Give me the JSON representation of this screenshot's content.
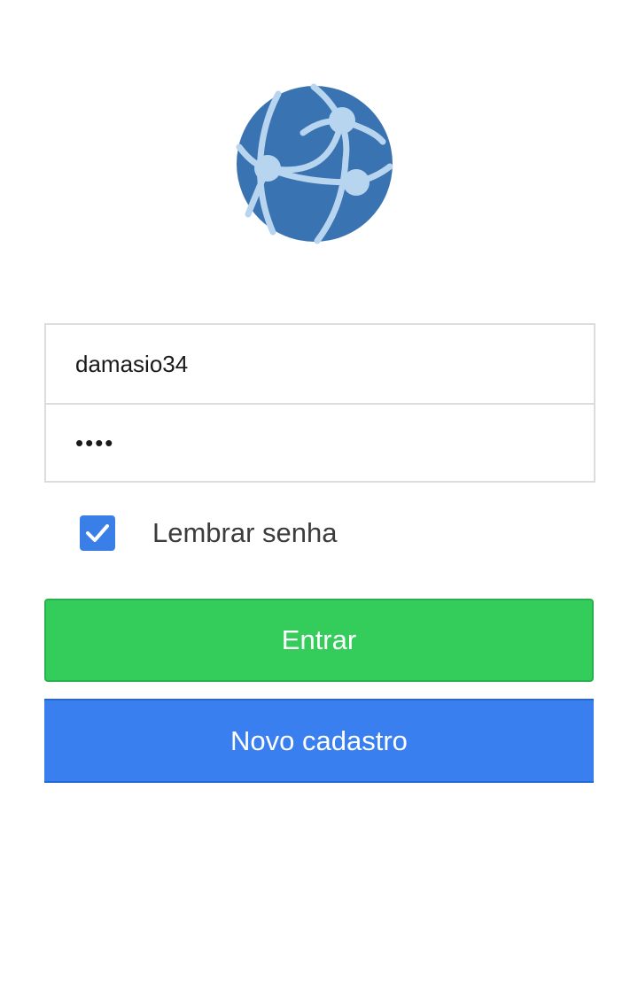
{
  "app": {
    "logo_icon": "globe-network-icon",
    "colors": {
      "logo_primary": "#3a73b2",
      "logo_accent": "#b8d5ef",
      "login_button": "#34cc5a",
      "register_button": "#3a7fef",
      "checkbox": "#3a7ee8"
    }
  },
  "login": {
    "username": "damasio34",
    "password": "abcd",
    "remember_checked": true,
    "remember_label": "Lembrar senha",
    "submit_label": "Entrar",
    "register_label": "Novo cadastro"
  }
}
